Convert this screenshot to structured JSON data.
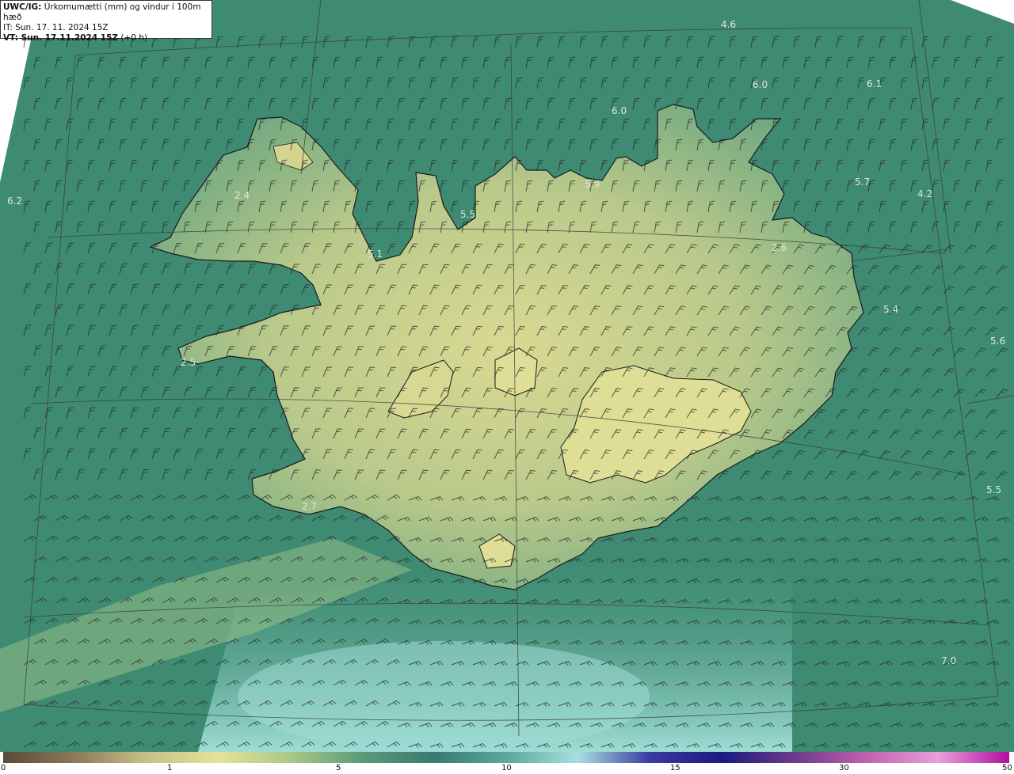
{
  "header": {
    "code": "UWC/IG:",
    "title": "Úrkomumætti (mm) og vindur í 100m hæð",
    "it_line": "IT: Sun. 17. 11. 2024 15Z",
    "vt_label": "VT: Sun. 17.11.2024 15Z",
    "vt_offset": "(+0 h)"
  },
  "values": [
    {
      "label": "4.6"
    },
    {
      "label": "6.0"
    },
    {
      "label": "6.1"
    },
    {
      "label": "6.0"
    },
    {
      "label": "6.2"
    },
    {
      "label": "2.4"
    },
    {
      "label": "5.9"
    },
    {
      "label": "5.7"
    },
    {
      "label": "4.2"
    },
    {
      "label": "5.5"
    },
    {
      "label": "5.1"
    },
    {
      "label": "2.6"
    },
    {
      "label": "5.4"
    },
    {
      "label": "5.6"
    },
    {
      "label": "2.5"
    },
    {
      "label": "5.5"
    },
    {
      "label": "2.7"
    },
    {
      "label": "7.0"
    }
  ],
  "colorbar": {
    "ticks": [
      "0",
      "1",
      "5",
      "10",
      "15",
      "30",
      "50"
    ],
    "colors": [
      "#5a4a3a",
      "#8a7a5a",
      "#c8c088",
      "#e6e29a",
      "#a8c888",
      "#5a9a7a",
      "#3a7a70",
      "#5aa8a0",
      "#a8e0e0",
      "#3a3aa0",
      "#1a1a80",
      "#6a3a8a",
      "#c060b0",
      "#e8a0d8",
      "#b010a0"
    ]
  },
  "colors": {
    "sea": "#3f8a72",
    "land_low": "#8db57a",
    "land_high": "#d8d890",
    "south_sea": "#8fd0c8"
  }
}
